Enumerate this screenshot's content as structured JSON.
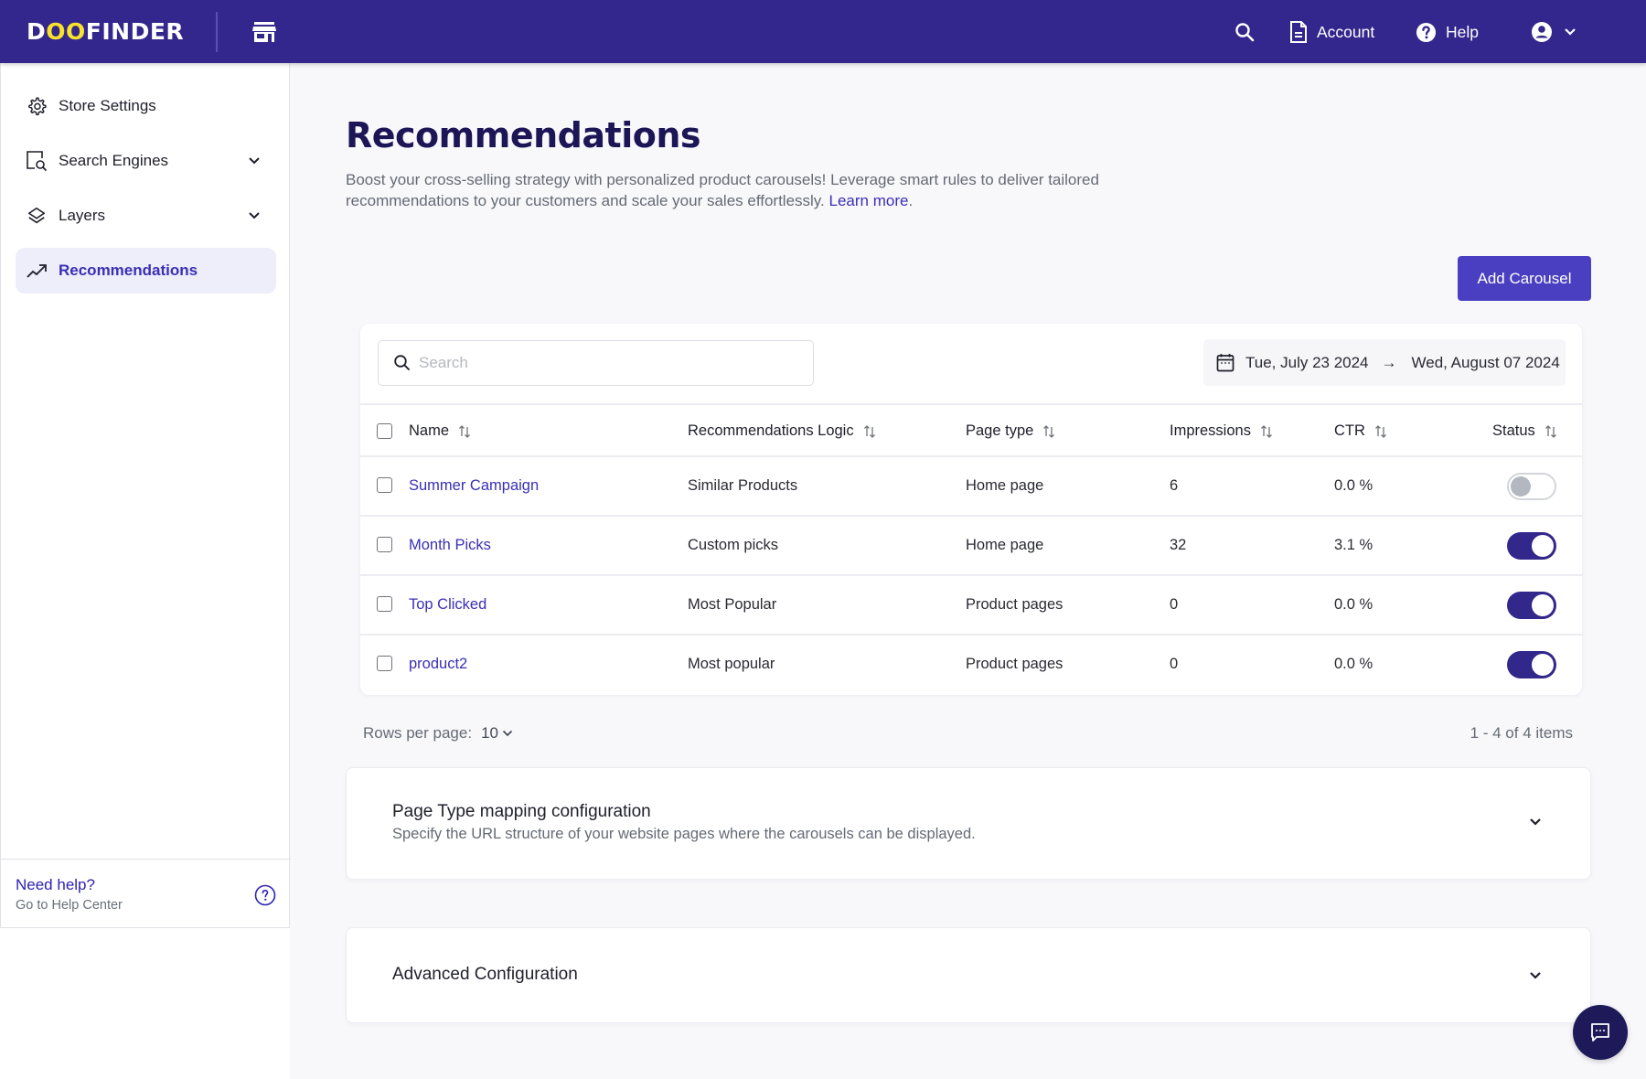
{
  "header": {
    "logo_prefix": "D",
    "logo_oo": "OO",
    "logo_suffix": "FINDER",
    "store_icon": "store-icon",
    "search_icon": "search-icon",
    "account_label": "Account",
    "help_label": "Help",
    "user_icon": "user-circle-icon"
  },
  "sidebar": {
    "items": [
      {
        "label": "Store Settings",
        "icon": "gear-icon",
        "expandable": false,
        "active": false
      },
      {
        "label": "Search Engines",
        "icon": "search-engine-icon",
        "expandable": true,
        "active": false
      },
      {
        "label": "Layers",
        "icon": "layers-icon",
        "expandable": true,
        "active": false
      },
      {
        "label": "Recommendations",
        "icon": "trending-up-icon",
        "expandable": false,
        "active": true
      }
    ],
    "footer": {
      "title": "Need help?",
      "subtitle": "Go to Help Center"
    }
  },
  "main": {
    "title": "Recommendations",
    "description": "Boost your cross-selling strategy with personalized product carousels! Leverage smart rules to deliver tailored recommendations to your customers and scale your sales effortlessly.",
    "learn_more": "Learn more",
    "add_button": "Add Carousel",
    "search": {
      "placeholder": "Search",
      "value": ""
    },
    "date_range": {
      "start": "Tue, July 23 2024",
      "arrow": "→",
      "end": "Wed, August 07 2024"
    },
    "table": {
      "columns": [
        "Name",
        "Recommendations Logic",
        "Page type",
        "Impressions",
        "CTR",
        "Status"
      ],
      "rows": [
        {
          "name": "Summer Campaign",
          "logic": "Similar Products",
          "page_type": "Home page",
          "impressions": "6",
          "ctr": "0.0 %",
          "status": "off"
        },
        {
          "name": "Month Picks",
          "logic": "Custom picks",
          "page_type": "Home page",
          "impressions": "32",
          "ctr": "3.1 %",
          "status": "on"
        },
        {
          "name": "Top Clicked",
          "logic": "Most Popular",
          "page_type": "Product pages",
          "impressions": "0",
          "ctr": "0.0 %",
          "status": "on"
        },
        {
          "name": "product2",
          "logic": "Most popular",
          "page_type": "Product pages",
          "impressions": "0",
          "ctr": "0.0 %",
          "status": "on"
        }
      ]
    },
    "pagination": {
      "rows_per_page_label": "Rows per page:",
      "rows_per_page_value": "10",
      "items_count": "1 - 4 of 4 items"
    },
    "accordions": [
      {
        "title": "Page Type mapping configuration",
        "subtitle": "Specify the URL structure of your website pages where the carousels can be displayed."
      },
      {
        "title": "Advanced Configuration"
      }
    ]
  },
  "colors": {
    "brand": "#33268c",
    "accent": "#4a3fc0",
    "link": "#3a2fb5",
    "logo_yellow": "#f8e22a",
    "toggle_on": "#32278a"
  }
}
